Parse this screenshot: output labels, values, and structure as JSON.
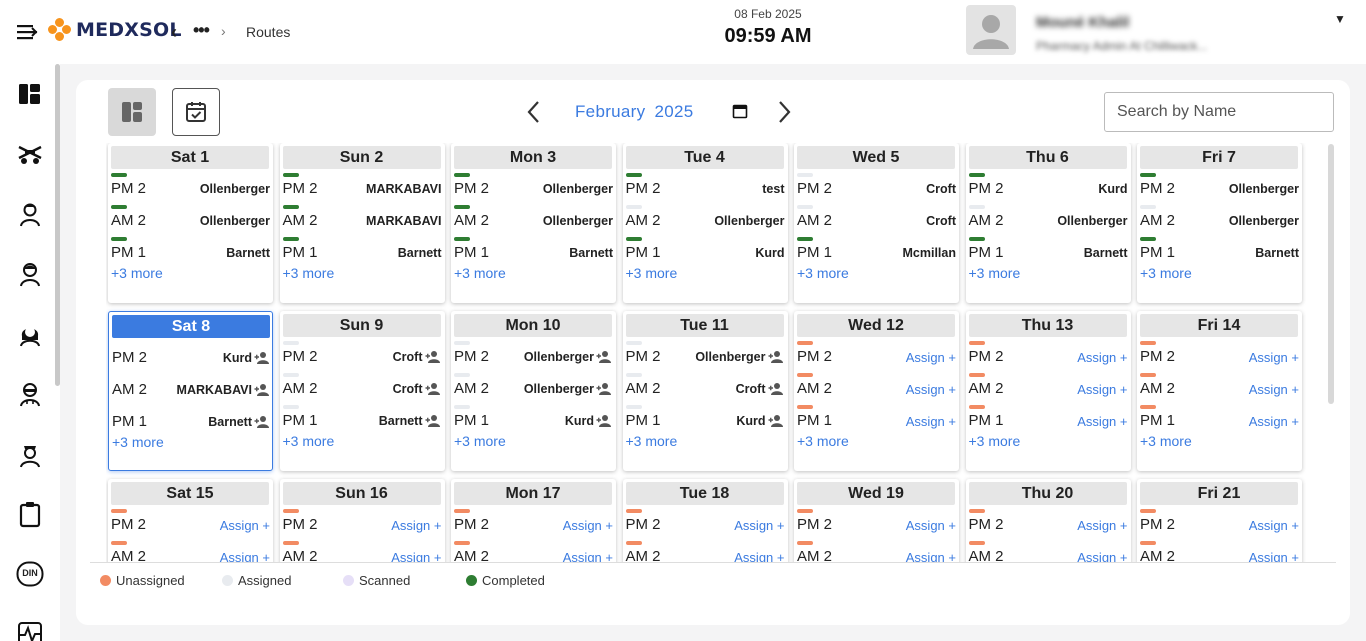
{
  "colors": {
    "unassigned": "#f28b63",
    "assigned": "#e8ebef",
    "scanned": "#e6dff7",
    "completed": "#2e7d32",
    "accent": "#3b7be0"
  },
  "header": {
    "app_name": "MEDXSOL",
    "collapse_glyph": "‹",
    "more_glyph": "•••",
    "breadcrumb_separator": "›",
    "breadcrumb_current": "Routes",
    "date": "08 Feb 2025",
    "time": "09:59 AM",
    "user_name": "Mouné Khalil",
    "user_role": "Pharmacy Admin At Chilliwack...",
    "user_caret": "▼"
  },
  "sidebar": {
    "items": [
      "dashboard-icon",
      "routes-icon",
      "driver-icon",
      "customer-icon",
      "pharmacist-icon",
      "doctor-icon",
      "nurse-icon",
      "clipboard-icon",
      "din-icon",
      "vitals-icon"
    ],
    "din_label": "DIN"
  },
  "calendar": {
    "month": "February",
    "year": "2025",
    "search_placeholder": "Search by Name",
    "more_label": "+3 more",
    "days": [
      {
        "label": "Sat 1",
        "routes": [
          {
            "label": "PM 2",
            "value": "Ollenberger",
            "status": "completed"
          },
          {
            "label": "AM 2",
            "value": "Ollenberger",
            "status": "completed"
          },
          {
            "label": "PM 1",
            "value": "Barnett",
            "status": "completed"
          }
        ]
      },
      {
        "label": "Sun 2",
        "routes": [
          {
            "label": "PM 2",
            "value": "MARKABAVI",
            "status": "completed"
          },
          {
            "label": "AM 2",
            "value": "MARKABAVI",
            "status": "completed"
          },
          {
            "label": "PM 1",
            "value": "Barnett",
            "status": "completed"
          }
        ]
      },
      {
        "label": "Mon 3",
        "routes": [
          {
            "label": "PM 2",
            "value": "Ollenberger",
            "status": "completed"
          },
          {
            "label": "AM 2",
            "value": "Ollenberger",
            "status": "completed"
          },
          {
            "label": "PM 1",
            "value": "Barnett",
            "status": "completed"
          }
        ]
      },
      {
        "label": "Tue 4",
        "routes": [
          {
            "label": "PM 2",
            "value": "test",
            "status": "completed"
          },
          {
            "label": "AM 2",
            "value": "Ollenberger",
            "status": "assigned"
          },
          {
            "label": "PM 1",
            "value": "Kurd",
            "status": "completed"
          }
        ]
      },
      {
        "label": "Wed 5",
        "routes": [
          {
            "label": "PM 2",
            "value": "Croft",
            "status": "assigned"
          },
          {
            "label": "AM 2",
            "value": "Croft",
            "status": "assigned"
          },
          {
            "label": "PM 1",
            "value": "Mcmillan",
            "status": "completed"
          }
        ]
      },
      {
        "label": "Thu 6",
        "routes": [
          {
            "label": "PM 2",
            "value": "Kurd",
            "status": "completed"
          },
          {
            "label": "AM 2",
            "value": "Ollenberger",
            "status": "assigned"
          },
          {
            "label": "PM 1",
            "value": "Barnett",
            "status": "completed"
          }
        ]
      },
      {
        "label": "Fri 7",
        "routes": [
          {
            "label": "PM 2",
            "value": "Ollenberger",
            "status": "completed"
          },
          {
            "label": "AM 2",
            "value": "Ollenberger",
            "status": "assigned"
          },
          {
            "label": "PM 1",
            "value": "Barnett",
            "status": "completed"
          }
        ]
      },
      {
        "label": "Sat 8",
        "selected": true,
        "routes": [
          {
            "label": "PM 2",
            "value": "Kurd",
            "status": "none",
            "icon": true
          },
          {
            "label": "AM 2",
            "value": "MARKABAVI",
            "status": "none",
            "icon": true
          },
          {
            "label": "PM 1",
            "value": "Barnett",
            "status": "none",
            "icon": true
          }
        ]
      },
      {
        "label": "Sun 9",
        "routes": [
          {
            "label": "PM 2",
            "value": "Croft",
            "status": "assigned",
            "icon": true
          },
          {
            "label": "AM 2",
            "value": "Croft",
            "status": "assigned",
            "icon": true
          },
          {
            "label": "PM 1",
            "value": "Barnett",
            "status": "assigned",
            "icon": true
          }
        ]
      },
      {
        "label": "Mon 10",
        "routes": [
          {
            "label": "PM 2",
            "value": "Ollenberger",
            "status": "assigned",
            "icon": true
          },
          {
            "label": "AM 2",
            "value": "Ollenberger",
            "status": "assigned",
            "icon": true
          },
          {
            "label": "PM 1",
            "value": "Kurd",
            "status": "assigned",
            "icon": true
          }
        ]
      },
      {
        "label": "Tue 11",
        "routes": [
          {
            "label": "PM 2",
            "value": "Ollenberger",
            "status": "assigned",
            "icon": true
          },
          {
            "label": "AM 2",
            "value": "Croft",
            "status": "assigned",
            "icon": true
          },
          {
            "label": "PM 1",
            "value": "Kurd",
            "status": "assigned",
            "icon": true
          }
        ]
      },
      {
        "label": "Wed 12",
        "routes": [
          {
            "label": "PM 2",
            "value": "Assign +",
            "status": "unassigned",
            "assign": true
          },
          {
            "label": "AM 2",
            "value": "Assign +",
            "status": "unassigned",
            "assign": true
          },
          {
            "label": "PM 1",
            "value": "Assign +",
            "status": "unassigned",
            "assign": true
          }
        ]
      },
      {
        "label": "Thu 13",
        "routes": [
          {
            "label": "PM 2",
            "value": "Assign +",
            "status": "unassigned",
            "assign": true
          },
          {
            "label": "AM 2",
            "value": "Assign +",
            "status": "unassigned",
            "assign": true
          },
          {
            "label": "PM 1",
            "value": "Assign +",
            "status": "unassigned",
            "assign": true
          }
        ]
      },
      {
        "label": "Fri 14",
        "routes": [
          {
            "label": "PM 2",
            "value": "Assign +",
            "status": "unassigned",
            "assign": true
          },
          {
            "label": "AM 2",
            "value": "Assign +",
            "status": "unassigned",
            "assign": true
          },
          {
            "label": "PM 1",
            "value": "Assign +",
            "status": "unassigned",
            "assign": true
          }
        ]
      },
      {
        "label": "Sat 15",
        "routes": [
          {
            "label": "PM 2",
            "value": "Assign +",
            "status": "unassigned",
            "assign": true
          },
          {
            "label": "AM 2",
            "value": "Assign +",
            "status": "unassigned",
            "assign": true
          }
        ]
      },
      {
        "label": "Sun 16",
        "routes": [
          {
            "label": "PM 2",
            "value": "Assign +",
            "status": "unassigned",
            "assign": true
          },
          {
            "label": "AM 2",
            "value": "Assign +",
            "status": "unassigned",
            "assign": true
          }
        ]
      },
      {
        "label": "Mon 17",
        "routes": [
          {
            "label": "PM 2",
            "value": "Assign +",
            "status": "unassigned",
            "assign": true
          },
          {
            "label": "AM 2",
            "value": "Assign +",
            "status": "unassigned",
            "assign": true
          }
        ]
      },
      {
        "label": "Tue 18",
        "routes": [
          {
            "label": "PM 2",
            "value": "Assign +",
            "status": "unassigned",
            "assign": true
          },
          {
            "label": "AM 2",
            "value": "Assign +",
            "status": "unassigned",
            "assign": true
          }
        ]
      },
      {
        "label": "Wed 19",
        "routes": [
          {
            "label": "PM 2",
            "value": "Assign +",
            "status": "unassigned",
            "assign": true
          },
          {
            "label": "AM 2",
            "value": "Assign +",
            "status": "unassigned",
            "assign": true
          }
        ]
      },
      {
        "label": "Thu 20",
        "routes": [
          {
            "label": "PM 2",
            "value": "Assign +",
            "status": "unassigned",
            "assign": true
          },
          {
            "label": "AM 2",
            "value": "Assign +",
            "status": "unassigned",
            "assign": true
          }
        ]
      },
      {
        "label": "Fri 21",
        "routes": [
          {
            "label": "PM 2",
            "value": "Assign +",
            "status": "unassigned",
            "assign": true
          },
          {
            "label": "AM 2",
            "value": "Assign +",
            "status": "unassigned",
            "assign": true
          }
        ]
      }
    ]
  },
  "legend": [
    {
      "label": "Unassigned",
      "status": "unassigned"
    },
    {
      "label": "Assigned",
      "status": "assigned"
    },
    {
      "label": "Scanned",
      "status": "scanned"
    },
    {
      "label": "Completed",
      "status": "completed"
    }
  ]
}
